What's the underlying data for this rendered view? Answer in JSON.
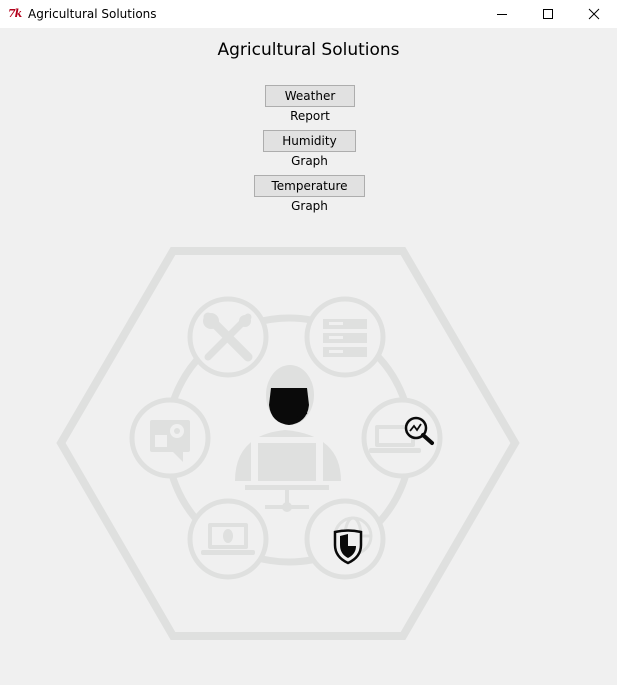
{
  "window": {
    "title": "Agricultural Solutions",
    "app_icon": "tk-feather-icon",
    "controls": [
      "minimize-icon",
      "maximize-icon",
      "close-icon"
    ]
  },
  "main": {
    "heading": "Agricultural Solutions",
    "buttons": [
      {
        "label": "Weather Report"
      },
      {
        "label": "Humidity Graph"
      },
      {
        "label": "Temperature Graph"
      }
    ]
  },
  "illustration": {
    "description_icons": [
      "hexagon-frame",
      "tools-icon",
      "server-icon",
      "analytics-search-icon",
      "global-security-icon",
      "bug-laptop-icon",
      "settings-chat-icon",
      "support-person-icon"
    ],
    "colors": {
      "faded": "#dfe0df",
      "dark": "#0a0a0a",
      "background": "#f0f0f0"
    }
  }
}
